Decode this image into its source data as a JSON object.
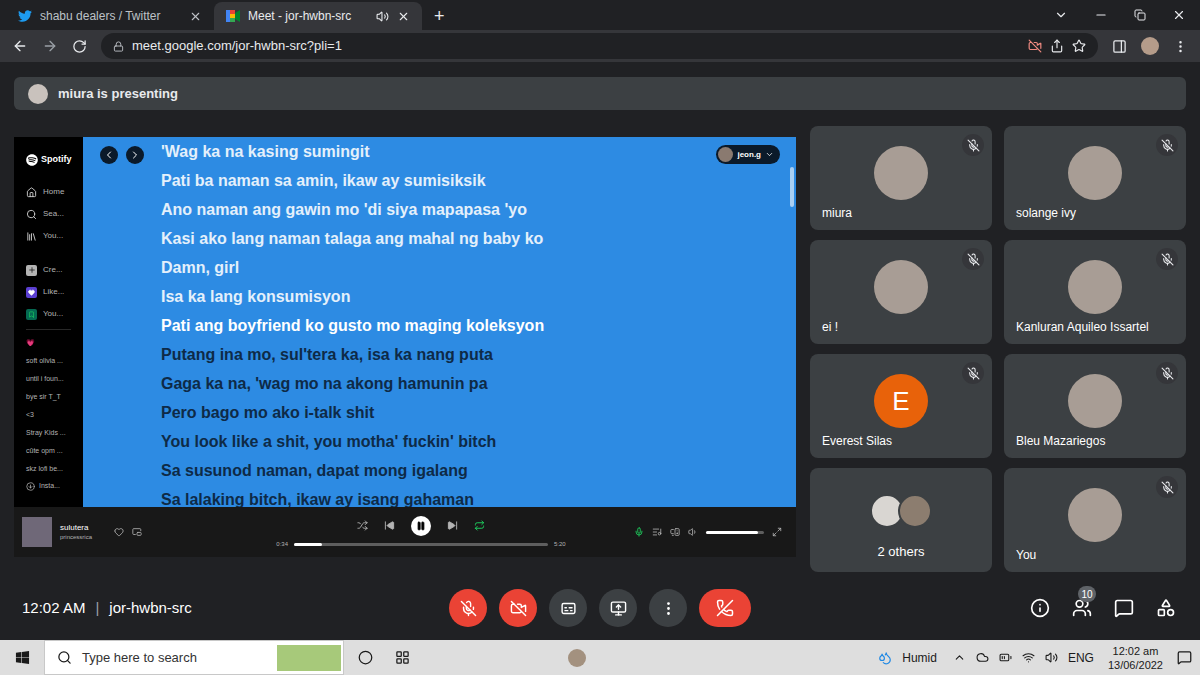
{
  "browser": {
    "tabs": [
      {
        "title": "shabu dealers / Twitter",
        "selected": false,
        "audio": false
      },
      {
        "title": "Meet - jor-hwbn-src",
        "selected": true,
        "audio": true
      }
    ],
    "new_tab": "+",
    "url": "meet.google.com/jor-hwbn-src?pli=1"
  },
  "meet": {
    "presenting": "miura is presenting",
    "time": "12:02 AM",
    "separator": "|",
    "code": "jor-hwbn-src",
    "people_count": "10",
    "mic_on": false,
    "camera_on": false
  },
  "spotify": {
    "logo": "Spotify",
    "nav": [
      "Home",
      "Sea...",
      "You..."
    ],
    "actions": [
      "Cre...",
      "Like...",
      "You..."
    ],
    "playlists": [
      "💗",
      "soft olivia ...",
      "until i foun...",
      "bye sir T_T",
      "<3",
      "Stray Kids ...",
      "cŭte opm ...",
      "skz lofi be..."
    ],
    "install": "Insta...",
    "user": "jeon.g",
    "lyrics": [
      {
        "text": "'Wag ka na kasing sumingit",
        "state": "past"
      },
      {
        "text": "Pati ba naman sa amin, ikaw ay sumisiksik",
        "state": "past"
      },
      {
        "text": "Ano naman ang gawin mo 'di siya mapapasa 'yo",
        "state": "past"
      },
      {
        "text": "Kasi ako lang naman talaga ang mahal ng baby ko",
        "state": "past"
      },
      {
        "text": "Damn, girl",
        "state": "past"
      },
      {
        "text": "Isa ka lang konsumisyon",
        "state": "past"
      },
      {
        "text": "Pati ang boyfriend ko gusto mo maging koleksyon",
        "state": "current"
      },
      {
        "text": "Putang ina mo, sul'tera ka, isa ka nang puta",
        "state": "upcoming"
      },
      {
        "text": "Gaga ka na, 'wag mo na akong hamunin pa",
        "state": "upcoming"
      },
      {
        "text": "Pero bago mo ako i-talk shit",
        "state": "upcoming"
      },
      {
        "text": "You look like a shit, you motha' fuckin' bitch",
        "state": "upcoming"
      },
      {
        "text": "Sa susunod naman, dapat mong igalang",
        "state": "upcoming"
      },
      {
        "text": "Sa lalaking bitch, ikaw ay isang gahaman",
        "state": "upcoming"
      }
    ],
    "track": {
      "title": "sulutera",
      "artist": "princessrica",
      "elapsed": "0:34",
      "duration": "5:20",
      "progress": 0.11,
      "playing": true,
      "liked": false,
      "repeat": true,
      "shuffle": false
    },
    "volume": 0.9
  },
  "participants": [
    {
      "name": "miura",
      "muted": true,
      "kind": "photo"
    },
    {
      "name": "solange ivy",
      "muted": true,
      "kind": "photo"
    },
    {
      "name": "ei !",
      "muted": true,
      "kind": "photo"
    },
    {
      "name": "Kanluran Aquileo Issartel",
      "muted": true,
      "kind": "photo"
    },
    {
      "name": "Everest Silas",
      "muted": true,
      "kind": "letter",
      "initial": "E",
      "color": "#e8620a"
    },
    {
      "name": "Bleu Mazariegos",
      "muted": true,
      "kind": "photo"
    },
    {
      "name": "2 others",
      "muted": false,
      "kind": "group"
    },
    {
      "name": "You",
      "muted": true,
      "kind": "photo"
    }
  ],
  "taskbar": {
    "search_placeholder": "Type here to search",
    "weather": "Humid",
    "language": "ENG",
    "time": "12:02 am",
    "date": "13/06/2022"
  }
}
